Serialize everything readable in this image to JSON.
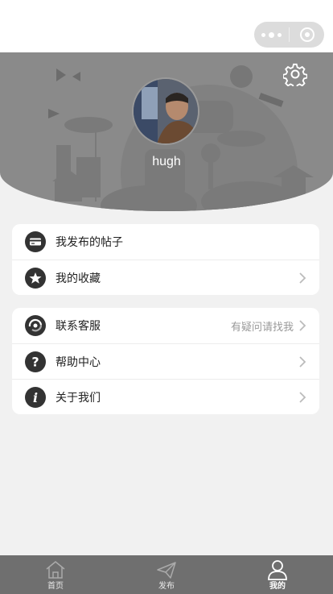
{
  "profile": {
    "username": "hugh"
  },
  "group1": [
    {
      "label": "我发布的帖子",
      "icon": "card-icon",
      "has_chevron": false
    },
    {
      "label": "我的收藏",
      "icon": "star-icon",
      "has_chevron": true
    }
  ],
  "group2": [
    {
      "label": "联系客服",
      "icon": "service-icon",
      "hint": "有疑问请找我",
      "has_chevron": true
    },
    {
      "label": "帮助中心",
      "icon": "question-icon",
      "has_chevron": true
    },
    {
      "label": "关于我们",
      "icon": "info-icon",
      "has_chevron": true
    }
  ],
  "tabbar": [
    {
      "label": "首页",
      "icon": "home-icon",
      "active": false
    },
    {
      "label": "发布",
      "icon": "send-icon",
      "active": false
    },
    {
      "label": "我的",
      "icon": "user-icon",
      "active": true
    }
  ],
  "colors": {
    "header_bg": "#8a8a8a",
    "icon_circle": "#333333",
    "tabbar_bg": "#6f6f6f",
    "page_bg": "#f1f1f1"
  }
}
